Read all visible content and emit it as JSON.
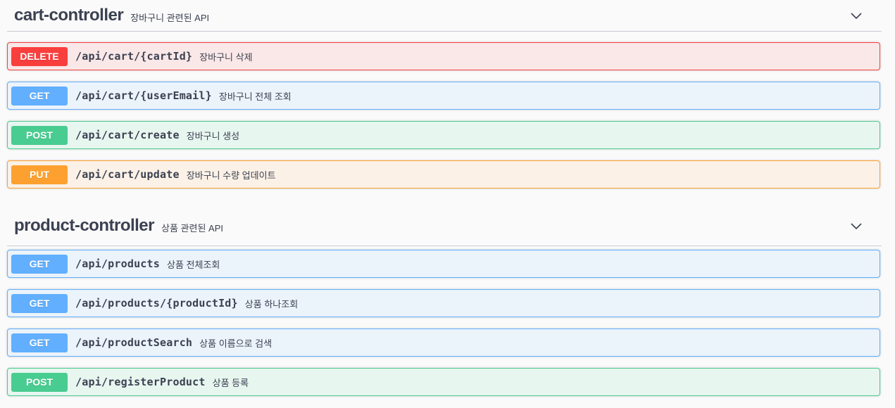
{
  "sections": [
    {
      "name": "cart-controller",
      "description": "장바구니 관련된 API",
      "toggle_icon": "chevron-down-icon",
      "operations": [
        {
          "method": "DELETE",
          "path": "/api/cart/{cartId}",
          "summary": "장바구니 삭제"
        },
        {
          "method": "GET",
          "path": "/api/cart/{userEmail}",
          "summary": "장바구니 전체 조회"
        },
        {
          "method": "POST",
          "path": "/api/cart/create",
          "summary": "장바구니 생성"
        },
        {
          "method": "PUT",
          "path": "/api/cart/update",
          "summary": "장바구니 수량 업데이트"
        }
      ]
    },
    {
      "name": "product-controller",
      "description": "상품 관련된 API",
      "toggle_icon": "chevron-down-icon",
      "operations": [
        {
          "method": "GET",
          "path": "/api/products",
          "summary": "상품 전체조회"
        },
        {
          "method": "GET",
          "path": "/api/products/{productId}",
          "summary": "상품 하나조회"
        },
        {
          "method": "GET",
          "path": "/api/productSearch",
          "summary": "상품 이름으로 검색"
        },
        {
          "method": "POST",
          "path": "/api/registerProduct",
          "summary": "상품 등록"
        }
      ]
    }
  ],
  "colors": {
    "delete": "#f93e3e",
    "get": "#61affe",
    "post": "#49cc90",
    "put": "#fca130",
    "text": "#3b4151"
  }
}
